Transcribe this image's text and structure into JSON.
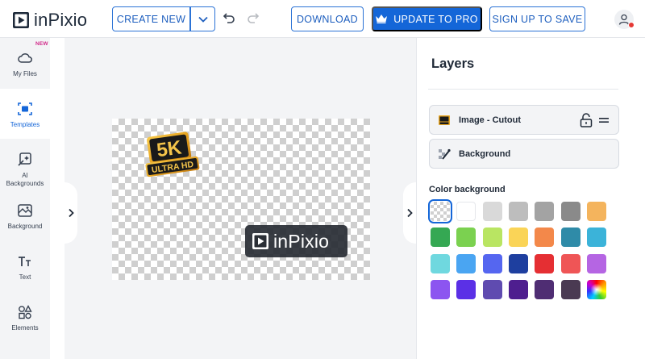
{
  "app": {
    "logo_text": "inPixio"
  },
  "toolbar": {
    "create_new": "CREATE NEW",
    "download": "DOWNLOAD",
    "update_pro": "UPDATE TO PRO",
    "signup": "SIGN UP TO SAVE"
  },
  "sidebar": {
    "items": [
      {
        "label": "My Files",
        "badge": "NEW"
      },
      {
        "label": "Templates"
      },
      {
        "label": "AI\nBackgrounds"
      },
      {
        "label": "Background"
      },
      {
        "label": "Text"
      },
      {
        "label": "Elements"
      }
    ]
  },
  "canvas": {
    "sticker_big": "5K",
    "sticker_small": "ULTRA HD",
    "watermark_text": "inPixio"
  },
  "layers": {
    "title": "Layers",
    "items": [
      {
        "label": "Image - Cutout"
      },
      {
        "label": "Background"
      }
    ]
  },
  "color_background": {
    "title": "Color background",
    "swatches": [
      "transparent",
      "#ffffff",
      "#d9d9d9",
      "#bdbdbd",
      "#a3a3a3",
      "#8a8a8a",
      "#f4b45d",
      "#35a853",
      "#7bd150",
      "#b9e562",
      "#fad457",
      "#f3884a",
      "#2f8ba8",
      "#3bb3d9",
      "#6fd8df",
      "#4aa5f2",
      "#5566f0",
      "#1e3f9f",
      "#e52f33",
      "#ef5556",
      "#b565e3",
      "#8c55f0",
      "#5b30e6",
      "#5f4bb0",
      "#4e1e8f",
      "#4f2d73",
      "#4a3a52",
      "rainbow"
    ],
    "selected_index": 0
  },
  "colors": {
    "accent": "#1466d8"
  }
}
